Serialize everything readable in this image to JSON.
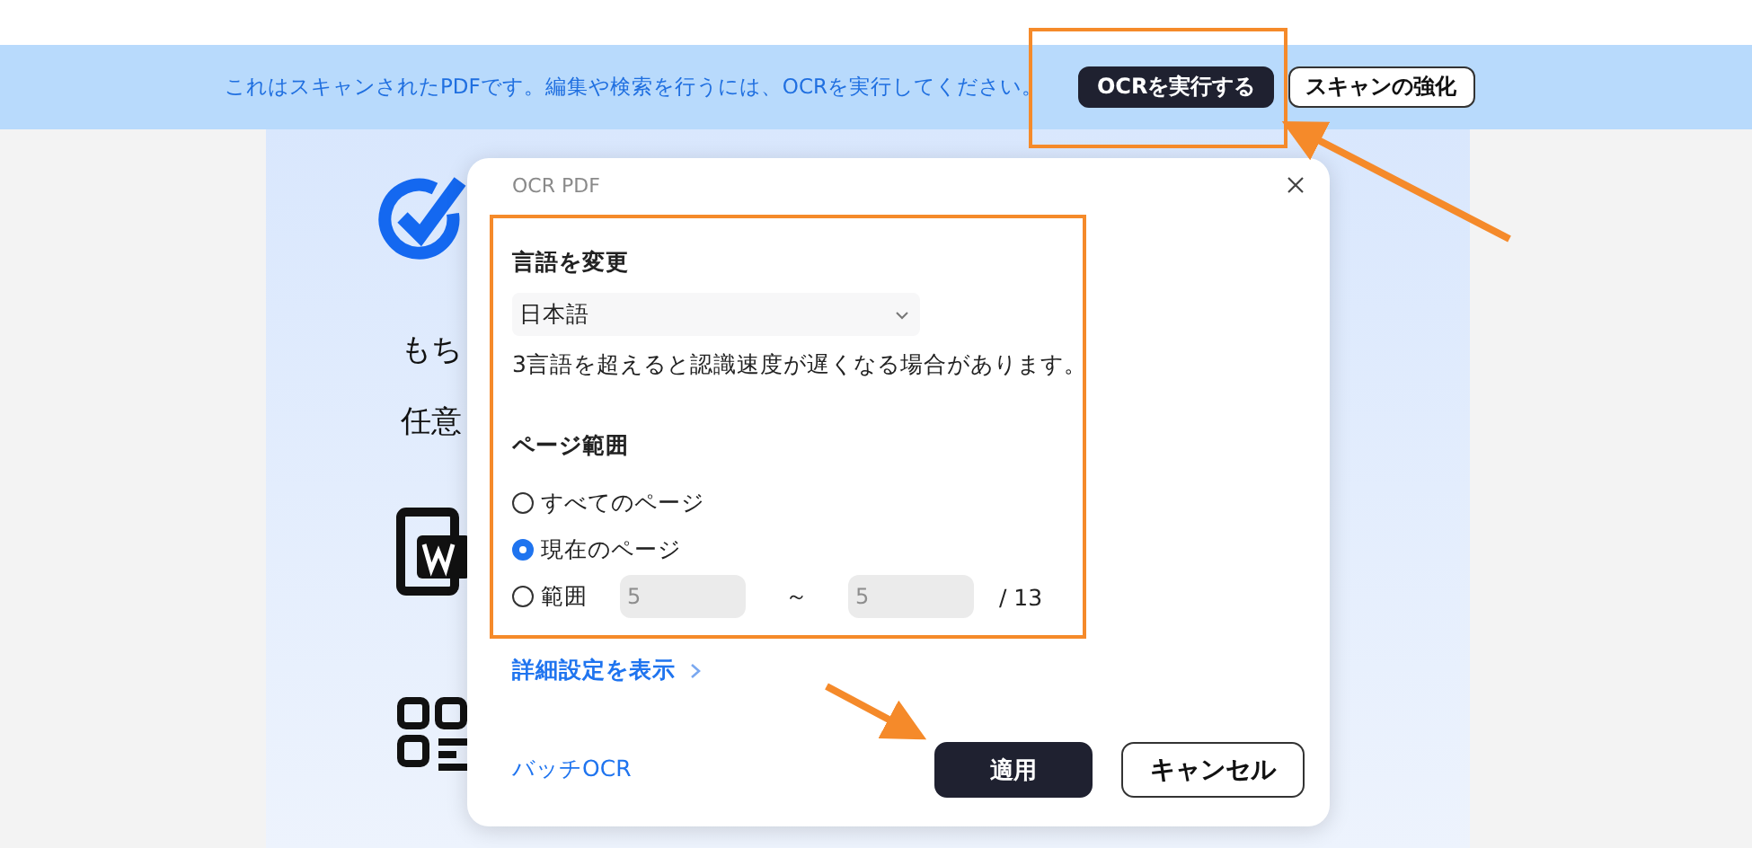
{
  "banner": {
    "message": "これはスキャンされたPDFです。編集や検索を行うには、OCRを実行してください。",
    "buttons": [
      {
        "label": "OCRを実行する",
        "kind": "primary"
      },
      {
        "label": "スキャンの強化",
        "kind": "secondary"
      }
    ]
  },
  "document": {
    "texts": [
      "もち",
      "任意"
    ]
  },
  "dialog": {
    "title": "OCR PDF",
    "language": {
      "heading": "言語を変更",
      "value": "日本語",
      "note": "3言語を超えると認識速度が遅くなる場合があります。"
    },
    "page_range": {
      "heading": "ページ範囲",
      "options": [
        {
          "label": "すべてのページ",
          "selected": false,
          "kind": "plain"
        },
        {
          "label": "現在のページ",
          "selected": true,
          "kind": "plain"
        },
        {
          "label": "範囲",
          "selected": false,
          "kind": "range"
        }
      ],
      "range": {
        "from": "5",
        "separator": "～",
        "to": "5",
        "total": "/ 13",
        "disabled": true
      }
    },
    "advanced_link": "詳細設定を表示",
    "batch_link": "バッチOCR",
    "buttons": [
      {
        "label": "適用",
        "kind": "primary"
      },
      {
        "label": "キャンセル",
        "kind": "secondary"
      }
    ]
  }
}
